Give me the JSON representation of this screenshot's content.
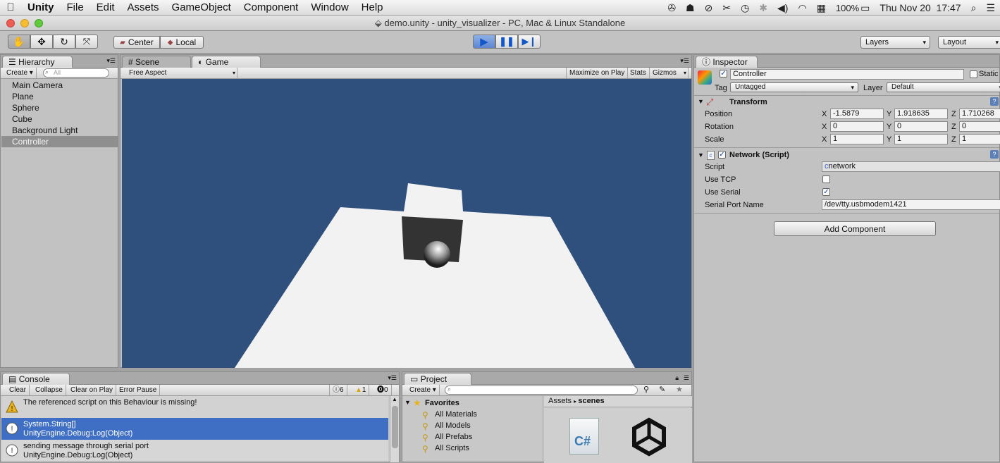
{
  "menubar": {
    "app": "Unity",
    "items": [
      "File",
      "Edit",
      "Assets",
      "GameObject",
      "Component",
      "Window",
      "Help"
    ],
    "battery": "100%",
    "clock": "Thu Nov 20  17:47"
  },
  "window": {
    "title": "demo.unity - unity_visualizer - PC, Mac & Linux Standalone"
  },
  "toolbar": {
    "pivot": "Center",
    "space": "Local",
    "layers": "Layers",
    "layout": "Layout"
  },
  "hierarchy": {
    "tab": "Hierarchy",
    "create": "Create",
    "search_placeholder": "All",
    "items": [
      "Main Camera",
      "Plane",
      "Sphere",
      "Cube",
      "Background Light",
      "Controller"
    ],
    "selected_index": 5
  },
  "scene": {
    "tab_scene": "Scene",
    "tab_game": "Game",
    "aspect": "Free Aspect",
    "maximize": "Maximize on Play",
    "stats": "Stats",
    "gizmos": "Gizmos",
    "colors": {
      "sky": "#2f4f7d",
      "ground": "#f2f2f2",
      "cube": "#333333"
    }
  },
  "inspector": {
    "tab": "Inspector",
    "object_name": "Controller",
    "static_label": "Static",
    "tag_label": "Tag",
    "tag_value": "Untagged",
    "layer_label": "Layer",
    "layer_value": "Default",
    "transform": {
      "title": "Transform",
      "rows": [
        {
          "label": "Position",
          "x": "-1.5879",
          "y": "1.918635",
          "z": "1.710268"
        },
        {
          "label": "Rotation",
          "x": "0",
          "y": "0",
          "z": "0"
        },
        {
          "label": "Scale",
          "x": "1",
          "y": "1",
          "z": "1"
        }
      ],
      "axis_x": "X",
      "axis_y": "Y",
      "axis_z": "Z"
    },
    "network": {
      "title": "Network (Script)",
      "script_label": "Script",
      "script_value": "network",
      "use_tcp_label": "Use TCP",
      "use_tcp": false,
      "use_serial_label": "Use Serial",
      "use_serial": true,
      "serial_port_label": "Serial Port Name",
      "serial_port_value": "/dev/tty.usbmodem1421"
    },
    "add_component": "Add Component"
  },
  "console": {
    "tab": "Console",
    "buttons": [
      "Clear",
      "Collapse",
      "Clear on Play",
      "Error Pause"
    ],
    "count_info": "6",
    "count_warn": "1",
    "count_error": "0",
    "messages": [
      {
        "type": "warning",
        "line1": "The referenced script on this Behaviour is missing!",
        "line2": ""
      },
      {
        "type": "info",
        "line1": "System.String[]",
        "line2": "UnityEngine.Debug:Log(Object)"
      },
      {
        "type": "info",
        "line1": "sending message through serial port",
        "line2": "UnityEngine.Debug:Log(Object)"
      }
    ]
  },
  "project": {
    "tab": "Project",
    "create": "Create",
    "favorites_label": "Favorites",
    "favorites": [
      "All Materials",
      "All Models",
      "All Prefabs",
      "All Scripts"
    ],
    "breadcrumb_root": "Assets",
    "breadcrumb_current": "scenes",
    "csharp_glyph": "C#"
  }
}
